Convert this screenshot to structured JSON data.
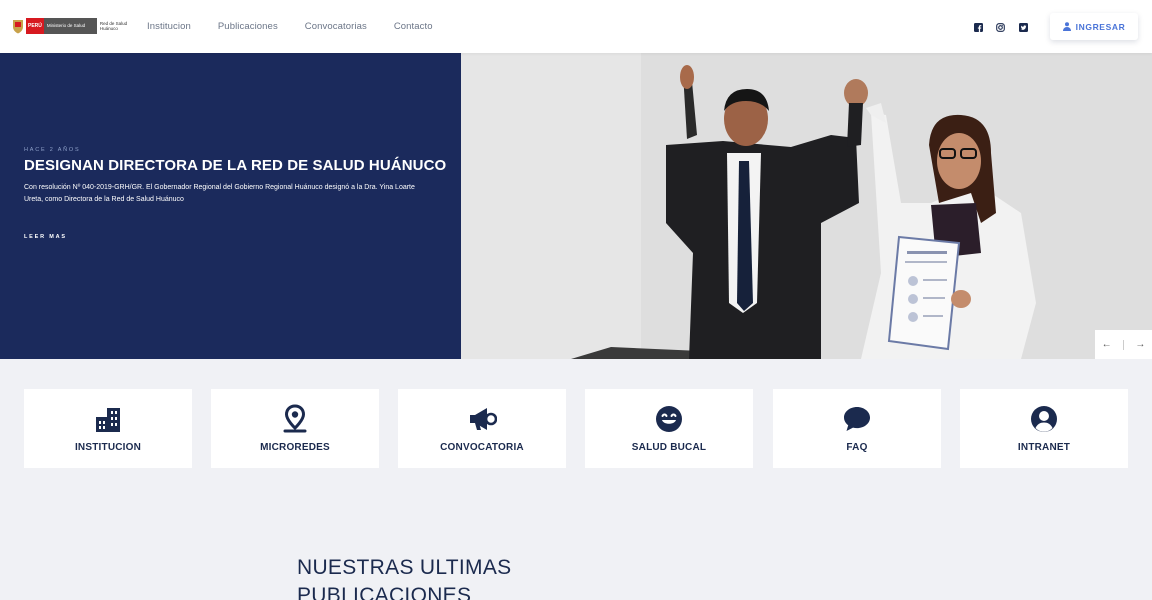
{
  "logo": {
    "country": "PERÚ",
    "ministry": "Ministerio de Salud",
    "entity": "Red de Salud Huánuco"
  },
  "nav": {
    "links": [
      "Institucion",
      "Publicaciones",
      "Convocatorias",
      "Contacto"
    ],
    "social": [
      "facebook-icon",
      "instagram-icon",
      "twitter-icon"
    ],
    "login_label": "INGRESAR"
  },
  "hero": {
    "time": "HACE 2 AÑOS",
    "title": "DESIGNAN DIRECTORA DE LA RED DE SALUD HUÁNUCO",
    "text": "Con resolución Nº 040-2019-GRH/GR. El Gobernador Regional del Gobierno Regional Huánuco designó a la Dra. Yina Loarte Ureta, como Directora de la Red de Salud Huánuco",
    "more": "LEER MAS",
    "prev": "←",
    "next": "→"
  },
  "cards": [
    {
      "label": "INSTITUCION",
      "icon": "building-icon"
    },
    {
      "label": "MICROREDES",
      "icon": "map-marker-icon"
    },
    {
      "label": "CONVOCATORIA",
      "icon": "megaphone-icon"
    },
    {
      "label": "SALUD BUCAL",
      "icon": "smile-icon"
    },
    {
      "label": "FAQ",
      "icon": "chat-bubble-icon"
    },
    {
      "label": "INTRANET",
      "icon": "user-circle-icon"
    }
  ],
  "section": {
    "title_line1": "NUESTRAS ULTIMAS",
    "title_line2": "PUBLICACIONES"
  },
  "colors": {
    "navy": "#1b2a5c",
    "accent": "#4a74d8",
    "background": "#f0f1f5"
  }
}
